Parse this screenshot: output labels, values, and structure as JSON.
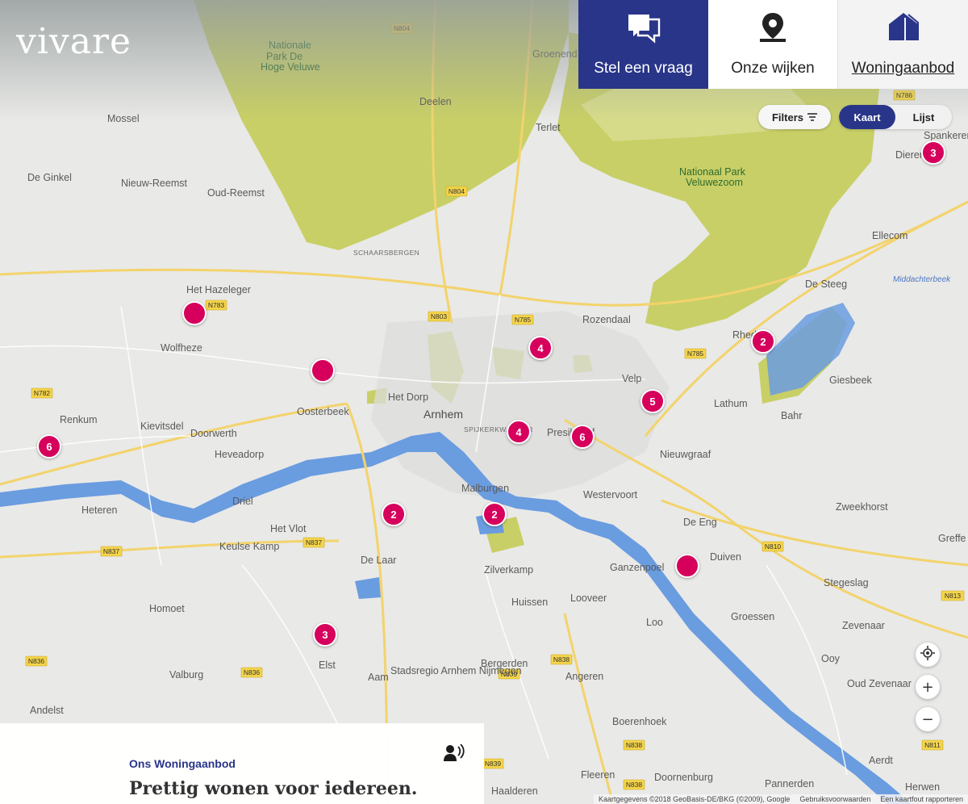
{
  "brand": {
    "logo_text": "vivare",
    "primary": "#293589",
    "marker": "#d6005c"
  },
  "nav": {
    "items": [
      {
        "label": "Stel een vraag",
        "icon": "chat-bubbles-icon"
      },
      {
        "label": "Onze wijken",
        "icon": "map-pin-icon"
      },
      {
        "label": "Woningaanbod",
        "icon": "house-icon"
      }
    ]
  },
  "controls": {
    "filters_label": "Filters",
    "view_map": "Kaart",
    "view_list": "Lijst"
  },
  "map": {
    "places": [
      "Mossel",
      "De Ginkel",
      "Nieuw-Reemst",
      "Oud-Reemst",
      "Deelen",
      "Terlet",
      "Groenend",
      "Het Hazeleger",
      "Wolfheze",
      "Renkum",
      "Kievitsdel",
      "Doorwerth",
      "Heveadorp",
      "Oosterbeek",
      "Het Dorp",
      "Arnhem",
      "Rozendaal",
      "Velp",
      "Rheden",
      "Lathum",
      "Bahr",
      "Giesbeek",
      "Ellecom",
      "De Steeg",
      "Dieren",
      "Spankeren",
      "Presikhaaf",
      "Nieuwgraaf",
      "Westervoort",
      "Malburgen",
      "Heteren",
      "Driel",
      "Het Vlot",
      "Keulse Kamp",
      "De Laar",
      "Zilverkamp",
      "Huissen",
      "Looveer",
      "Ganzenpoel",
      "Duiven",
      "De Eng",
      "Zweekhorst",
      "Groessen",
      "Stegeslag",
      "Zevenaar",
      "Loo",
      "Homoet",
      "Elst",
      "Valburg",
      "Andelst",
      "Aam",
      "Stadsregio Arnhem Nijmegen",
      "Bergerden",
      "Angeren",
      "Ooy",
      "Oud Zevenaar",
      "Boerenhoek",
      "Fleeren",
      "Doornenburg",
      "Haalderen",
      "Pannerden",
      "Aerdt",
      "Herwen",
      "Greffe",
      "Loo",
      "Nationale Park De Hoge Veluwe",
      "Nationaal Park Veluwezoom",
      "Middachterbeek",
      "SPIJKERKWARTIER",
      "SCHAARSBERGEN"
    ],
    "markers": [
      {
        "count": "3"
      },
      {
        "count": ""
      },
      {
        "count": ""
      },
      {
        "count": "4"
      },
      {
        "count": "2"
      },
      {
        "count": "5"
      },
      {
        "count": "6"
      },
      {
        "count": "4"
      },
      {
        "count": "6"
      },
      {
        "count": "2"
      },
      {
        "count": "2"
      },
      {
        "count": ""
      },
      {
        "count": "3"
      }
    ]
  },
  "panel": {
    "subtitle": "Ons Woningaanbod",
    "headline": "Prettig wonen voor iedereen."
  },
  "attribution": {
    "data": "Kaartgegevens ©2018 GeoBasis-DE/BKG (©2009), Google",
    "terms": "Gebruiksvoorwaarden",
    "report": "Een kaartfout rapporteren"
  }
}
